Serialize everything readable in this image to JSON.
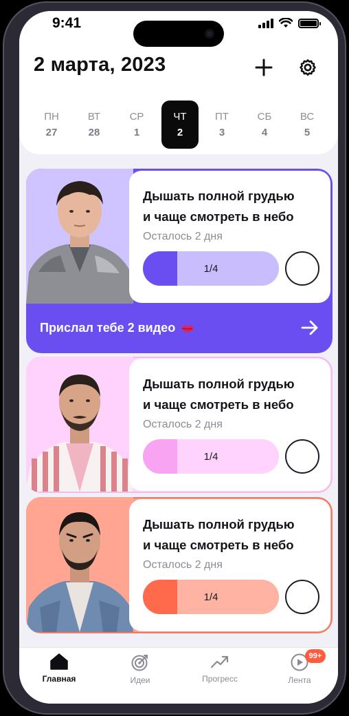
{
  "status_bar": {
    "time": "9:41"
  },
  "header": {
    "date_title": "2 марта, 2023",
    "add_icon": "plus-icon",
    "settings_icon": "gear-icon"
  },
  "week": {
    "days": [
      {
        "name": "ПН",
        "date": "27"
      },
      {
        "name": "ВТ",
        "date": "28"
      },
      {
        "name": "СР",
        "date": "1"
      },
      {
        "name": "ЧТ",
        "date": "2",
        "active": true
      },
      {
        "name": "ПТ",
        "date": "3"
      },
      {
        "name": "СБ",
        "date": "4"
      },
      {
        "name": "ВС",
        "date": "5"
      }
    ]
  },
  "cards": [
    {
      "goal_line1": "Дышать полной грудью",
      "goal_line2": "и чаще смотреть в небо",
      "remaining": "Осталось 2 дня",
      "progress_label": "1/4",
      "progress": 0.25,
      "message": "Прислал тебе 2 видео",
      "accent": "#6b4ef0"
    },
    {
      "goal_line1": "Дышать полной грудью",
      "goal_line2": "и чаще смотреть в небо",
      "remaining": "Осталось 2 дня",
      "progress_label": "1/4",
      "progress": 0.25,
      "accent": "#f9a3f3"
    },
    {
      "goal_line1": "Дышать полной грудью",
      "goal_line2": "и чаще смотреть в небо",
      "remaining": "Осталось 2 дня",
      "progress_label": "1/4",
      "progress": 0.25,
      "accent": "#ff6a4d"
    }
  ],
  "tabbar": {
    "tabs": [
      {
        "label": "Главная",
        "icon": "home-icon",
        "active": true
      },
      {
        "label": "Идеи",
        "icon": "target-icon"
      },
      {
        "label": "Прогресс",
        "icon": "trend-icon"
      },
      {
        "label": "Лента",
        "icon": "play-icon",
        "badge": "99+"
      }
    ]
  }
}
